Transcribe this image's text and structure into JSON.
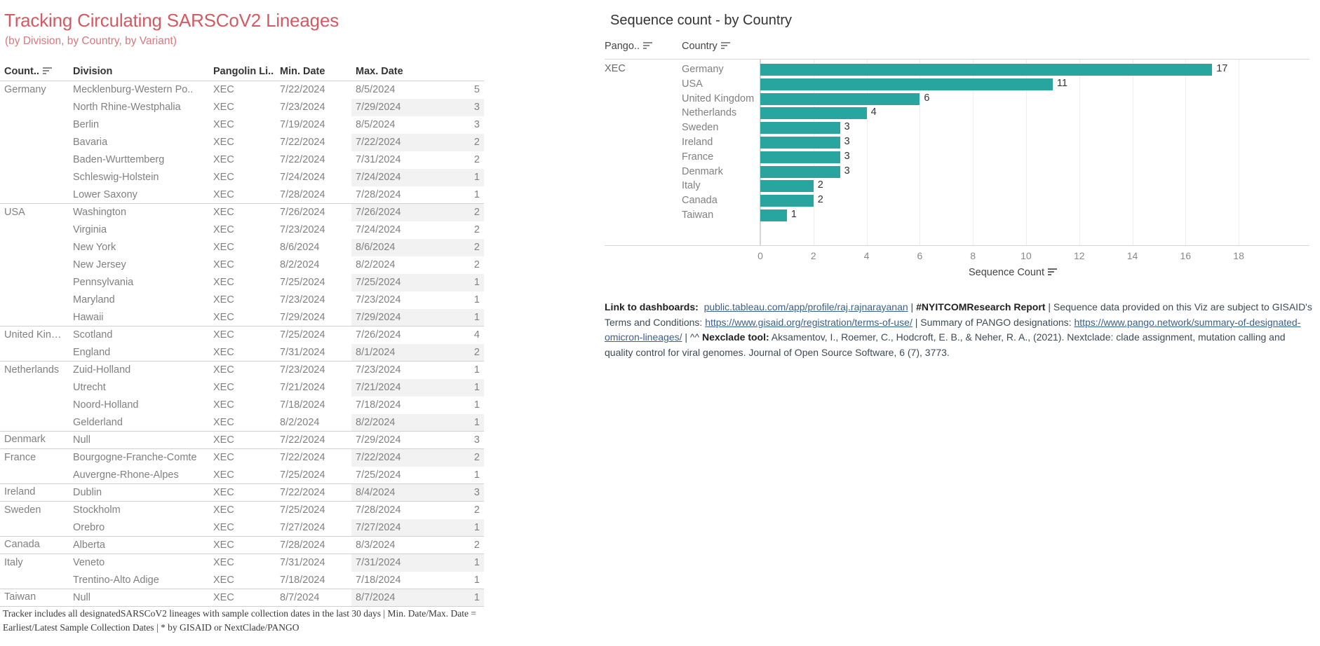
{
  "left": {
    "title": "Tracking Circulating SARSCoV2 Lineages",
    "subtitle": "(by Division, by Country, by Variant)",
    "table": {
      "columns": [
        "Count..",
        "Division",
        "Pangolin Li..",
        "Min. Date",
        "Max. Date",
        ""
      ],
      "sort_icon_column": "Count..",
      "rows": [
        {
          "country": "Germany",
          "division": "Mecklenburg-Western Po..",
          "lineage": "XEC",
          "min": "7/22/2024",
          "max": "8/5/2024",
          "count": "5",
          "group_start": true
        },
        {
          "country": "",
          "division": "North Rhine-Westphalia",
          "lineage": "XEC",
          "min": "7/23/2024",
          "max": "7/29/2024",
          "count": "3",
          "group_start": false
        },
        {
          "country": "",
          "division": "Berlin",
          "lineage": "XEC",
          "min": "7/19/2024",
          "max": "8/5/2024",
          "count": "3",
          "group_start": false
        },
        {
          "country": "",
          "division": "Bavaria",
          "lineage": "XEC",
          "min": "7/22/2024",
          "max": "7/22/2024",
          "count": "2",
          "group_start": false
        },
        {
          "country": "",
          "division": "Baden-Wurttemberg",
          "lineage": "XEC",
          "min": "7/22/2024",
          "max": "7/31/2024",
          "count": "2",
          "group_start": false
        },
        {
          "country": "",
          "division": "Schleswig-Holstein",
          "lineage": "XEC",
          "min": "7/24/2024",
          "max": "7/24/2024",
          "count": "1",
          "group_start": false
        },
        {
          "country": "",
          "division": "Lower Saxony",
          "lineage": "XEC",
          "min": "7/28/2024",
          "max": "7/28/2024",
          "count": "1",
          "group_start": false
        },
        {
          "country": "USA",
          "division": "Washington",
          "lineage": "XEC",
          "min": "7/26/2024",
          "max": "7/26/2024",
          "count": "2",
          "group_start": true
        },
        {
          "country": "",
          "division": "Virginia",
          "lineage": "XEC",
          "min": "7/23/2024",
          "max": "7/24/2024",
          "count": "2",
          "group_start": false
        },
        {
          "country": "",
          "division": "New York",
          "lineage": "XEC",
          "min": "8/6/2024",
          "max": "8/6/2024",
          "count": "2",
          "group_start": false
        },
        {
          "country": "",
          "division": "New Jersey",
          "lineage": "XEC",
          "min": "8/2/2024",
          "max": "8/2/2024",
          "count": "2",
          "group_start": false
        },
        {
          "country": "",
          "division": "Pennsylvania",
          "lineage": "XEC",
          "min": "7/25/2024",
          "max": "7/25/2024",
          "count": "1",
          "group_start": false
        },
        {
          "country": "",
          "division": "Maryland",
          "lineage": "XEC",
          "min": "7/23/2024",
          "max": "7/23/2024",
          "count": "1",
          "group_start": false
        },
        {
          "country": "",
          "division": "Hawaii",
          "lineage": "XEC",
          "min": "7/29/2024",
          "max": "7/29/2024",
          "count": "1",
          "group_start": false
        },
        {
          "country": "United Kingdom",
          "division": "Scotland",
          "lineage": "XEC",
          "min": "7/25/2024",
          "max": "7/26/2024",
          "count": "4",
          "group_start": true
        },
        {
          "country": "",
          "division": "England",
          "lineage": "XEC",
          "min": "7/31/2024",
          "max": "8/1/2024",
          "count": "2",
          "group_start": false
        },
        {
          "country": "Netherlands",
          "division": "Zuid-Holland",
          "lineage": "XEC",
          "min": "7/23/2024",
          "max": "7/23/2024",
          "count": "1",
          "group_start": true
        },
        {
          "country": "",
          "division": "Utrecht",
          "lineage": "XEC",
          "min": "7/21/2024",
          "max": "7/21/2024",
          "count": "1",
          "group_start": false
        },
        {
          "country": "",
          "division": "Noord-Holland",
          "lineage": "XEC",
          "min": "7/18/2024",
          "max": "7/18/2024",
          "count": "1",
          "group_start": false
        },
        {
          "country": "",
          "division": "Gelderland",
          "lineage": "XEC",
          "min": "8/2/2024",
          "max": "8/2/2024",
          "count": "1",
          "group_start": false
        },
        {
          "country": "Denmark",
          "division": "Null",
          "lineage": "XEC",
          "min": "7/22/2024",
          "max": "7/29/2024",
          "count": "3",
          "group_start": true
        },
        {
          "country": "France",
          "division": "Bourgogne-Franche-Comte",
          "lineage": "XEC",
          "min": "7/22/2024",
          "max": "7/22/2024",
          "count": "2",
          "group_start": true
        },
        {
          "country": "",
          "division": "Auvergne-Rhone-Alpes",
          "lineage": "XEC",
          "min": "7/25/2024",
          "max": "7/25/2024",
          "count": "1",
          "group_start": false
        },
        {
          "country": "Ireland",
          "division": "Dublin",
          "lineage": "XEC",
          "min": "7/22/2024",
          "max": "8/4/2024",
          "count": "3",
          "group_start": true
        },
        {
          "country": "Sweden",
          "division": "Stockholm",
          "lineage": "XEC",
          "min": "7/25/2024",
          "max": "7/28/2024",
          "count": "2",
          "group_start": true
        },
        {
          "country": "",
          "division": "Orebro",
          "lineage": "XEC",
          "min": "7/27/2024",
          "max": "7/27/2024",
          "count": "1",
          "group_start": false
        },
        {
          "country": "Canada",
          "division": "Alberta",
          "lineage": "XEC",
          "min": "7/28/2024",
          "max": "8/3/2024",
          "count": "2",
          "group_start": true
        },
        {
          "country": "Italy",
          "division": "Veneto",
          "lineage": "XEC",
          "min": "7/31/2024",
          "max": "7/31/2024",
          "count": "1",
          "group_start": true
        },
        {
          "country": "",
          "division": "Trentino-Alto Adige",
          "lineage": "XEC",
          "min": "7/18/2024",
          "max": "7/18/2024",
          "count": "1",
          "group_start": false
        },
        {
          "country": "Taiwan",
          "division": "Null",
          "lineage": "XEC",
          "min": "8/7/2024",
          "max": "8/7/2024",
          "count": "1",
          "group_start": true
        }
      ]
    },
    "footnote_line1": "Tracker includes all designatedSARSCoV2 lineages with sample collection dates in the last 30 days |  Min. Date/Max. Date =",
    "footnote_line2": "Earliest/Latest Sample Collection Dates |  * by GISAID or NextClade/PANGO"
  },
  "right": {
    "chart_title": "Sequence count - by Country",
    "header": {
      "pango": "Pango..",
      "country": "Country"
    },
    "pango_value": "XEC",
    "axis_title": "Sequence Count",
    "refs": {
      "lead": "Link to dashboards:",
      "link1": "public.tableau.com/app/profile/raj.rajnarayanan",
      "sep1": " | ",
      "bold1": "#NYITCOMResearch Report",
      "text1": " | Sequence data provided on this Viz are subject to GISAID's Terms and Conditions: ",
      "link2": "https://www.gisaid.org/registration/terms-of-use/",
      "text2": " | Summary of PANGO designations: ",
      "link3": "https://www.pango.network/summary-of-designated-omicron-lineages/",
      "text3": " | ^^ ",
      "bold2": "Nexclade tool:",
      "text4": " Aksamentov, I., Roemer, C., Hodcroft, E. B., & Neher, R. A., (2021). Nextclade: clade assignment, mutation calling and quality control for viral genomes. Journal of Open Source Software, 6 (7), 3773."
    }
  },
  "colors": {
    "title_red": "#d25b63",
    "bar_teal": "#29a5a0",
    "link_blue": "#3a5f8a"
  },
  "chart_data": {
    "type": "bar",
    "orientation": "horizontal",
    "title": "Sequence count - by Country",
    "xlabel": "Sequence Count",
    "ylabel": "Country",
    "xlim": [
      0,
      19
    ],
    "xticks": [
      0,
      2,
      4,
      6,
      8,
      10,
      12,
      14,
      16,
      18
    ],
    "grid": true,
    "legend": "none",
    "categories": [
      "Germany",
      "USA",
      "United Kingdom",
      "Netherlands",
      "Sweden",
      "Ireland",
      "France",
      "Denmark",
      "Italy",
      "Canada",
      "Taiwan"
    ],
    "values": [
      17,
      11,
      6,
      4,
      3,
      3,
      3,
      3,
      2,
      2,
      1
    ],
    "series": [
      {
        "name": "XEC",
        "values": [
          17,
          11,
          6,
          4,
          3,
          3,
          3,
          3,
          2,
          2,
          1
        ]
      }
    ]
  }
}
